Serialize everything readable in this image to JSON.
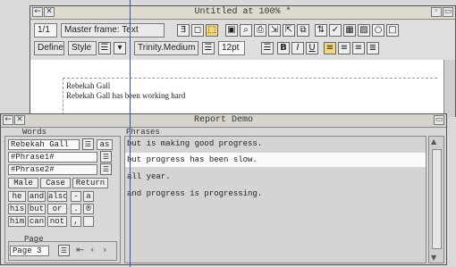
{
  "editor": {
    "title": "Untitled at 100% *",
    "page_count": "1/1",
    "master_frame": "Master frame: Text",
    "define_label": "Define",
    "style_label": "Style",
    "font_name": "Trinity.Medium",
    "font_size": "12pt",
    "bold": "B",
    "italic": "I",
    "underline": "U",
    "doc_lines": [
      "Rebekah Gall",
      "Rebekah Gall has been working hard"
    ]
  },
  "report": {
    "title": "Report Demo",
    "words_heading": "Words",
    "phrases_heading": "Phrases",
    "name_value": "Rebekah Gall",
    "as_label": "as",
    "phrase1": "#Phrase1#",
    "phrase2": "#Phrase2#",
    "male_label": "Male",
    "case_label": "Case",
    "return_label": "Return",
    "word_buttons": [
      "he",
      "and",
      "also",
      "his",
      "but",
      "or",
      "him",
      "can",
      "not"
    ],
    "punct_buttons": [
      "-",
      "a",
      ".",
      "®",
      ",",
      ""
    ],
    "page_heading": "Page",
    "page_value": "Page 3",
    "phrases": [
      "but is making good progress.",
      "but progress has been slow.",
      "all year.",
      "and progress is progressing."
    ]
  }
}
